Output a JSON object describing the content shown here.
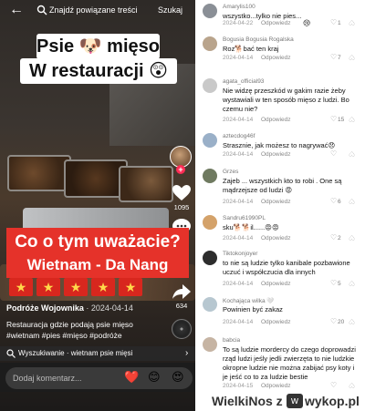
{
  "video": {
    "topbar": {
      "search_text": "Znajdź powiązane treści",
      "search_button": "Szukaj"
    },
    "title_line1": "Psie 🐶 mięso",
    "title_line2": "W restauracji 😲",
    "banner_line1": "Co o tym uważacie?",
    "banner_line2": "Wietnam - Da Nang",
    "stars": [
      "★",
      "★",
      "★",
      "★",
      "★",
      "★"
    ],
    "actions": {
      "likes": "1095",
      "comments": "97",
      "shares": "634"
    },
    "author": "Podróże Wojownika",
    "date": "· 2024-04-14",
    "description": "Restauracja gdzie podają psie mięso #wietnam #pies #mięso #podróże",
    "search_strip": "Wyszukiwanie · wietnam psie mięsi",
    "comment_placeholder": "Dodaj komentarz...",
    "emojis": [
      "❤️",
      "😊",
      "😍"
    ]
  },
  "comments": [
    {
      "name": "Amarylis100",
      "text": "wszystko...tylko nie pies...",
      "date": "2024-04-22",
      "reply": "Odpowiedz",
      "reaction": "😢",
      "likes": "1"
    },
    {
      "name": "Bogusia Bogusia Rogalska",
      "text": "Roz🐕bać ten kraj",
      "date": "2024-04-14",
      "reply": "Odpowiedz",
      "reaction": "",
      "likes": "7"
    },
    {
      "name": "agata_official93",
      "text": "Nie widzę przeszkód w gakim razie żeby wystawiali w ten sposób mięso z ludzi. Bo czemu nie?",
      "date": "2024-04-14",
      "reply": "Odpowiedz",
      "reaction": "",
      "likes": "15"
    },
    {
      "name": "aztecdog46f",
      "text": "Strasznie, jak możesz to nagrywać😞",
      "date": "2024-04-14",
      "reply": "Odpowiedz",
      "reaction": "",
      "likes": ""
    },
    {
      "name": "Grzes",
      "text": "Zajeb ... wszystkich kto to robi . One są mądrzejsze od ludzi 😡",
      "date": "2024-04-14",
      "reply": "Odpowiedz",
      "reaction": "",
      "likes": "6"
    },
    {
      "name": "Sandru61990PL",
      "text": "sku🐕🐕il......😡😡",
      "date": "2024-04-14",
      "reply": "Odpowiedz",
      "reaction": "",
      "likes": "2"
    },
    {
      "name": "Tiktokonjoyer",
      "text": "to nie są ludzie tylko kanibale pozbawione uczuć i współczucia dla innych",
      "date": "2024-04-14",
      "reply": "Odpowiedz",
      "reaction": "",
      "likes": "5"
    },
    {
      "name": "Kochająca wilka 🤍",
      "text": "Powinien być zakaz",
      "date": "2024-04-14",
      "reply": "Odpowiedz",
      "reaction": "",
      "likes": "20"
    },
    {
      "name": "babcia",
      "text": "To są ludzie mordercy do czego doprowadzi rząd ludzi jeśly jedli zwierzęta to nie ludzkie okropne ludzie nie można zabijać psy koty i je jeść co to za ludzie bestie",
      "date": "2024-04-15",
      "reply": "Odpowiedz",
      "reaction": "",
      "likes": ""
    }
  ],
  "watermark": {
    "left": "WielkiNos z",
    "right": "wykop.pl"
  },
  "colors": {
    "tiktok_red": "#fe2c55",
    "banner_red": "#e5322a"
  }
}
